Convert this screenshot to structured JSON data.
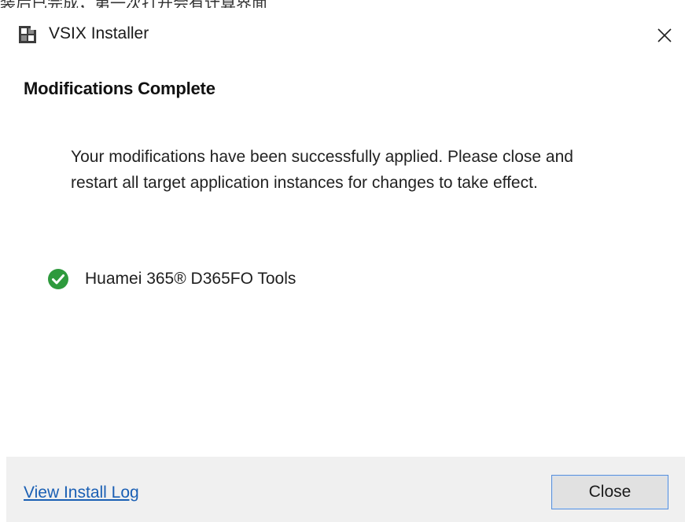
{
  "window": {
    "title": "VSIX Installer",
    "app_icon": "vsix-installer-icon",
    "close_icon": "close-icon",
    "top_strip_text": "装后已完成，第一次打开会有计算界面"
  },
  "main": {
    "heading": "Modifications Complete",
    "message": "Your modifications have been successfully applied. Please close and restart all target application instances for changes to take effect.",
    "installed_extensions": [
      {
        "name": "Huamei 365® D365FO Tools",
        "status_icon": "checkmark-circle-icon",
        "status_color": "#2e9a3d"
      }
    ]
  },
  "footer": {
    "view_log_label": "View Install Log",
    "close_label": "Close",
    "link_color": "#1a5fb4"
  }
}
